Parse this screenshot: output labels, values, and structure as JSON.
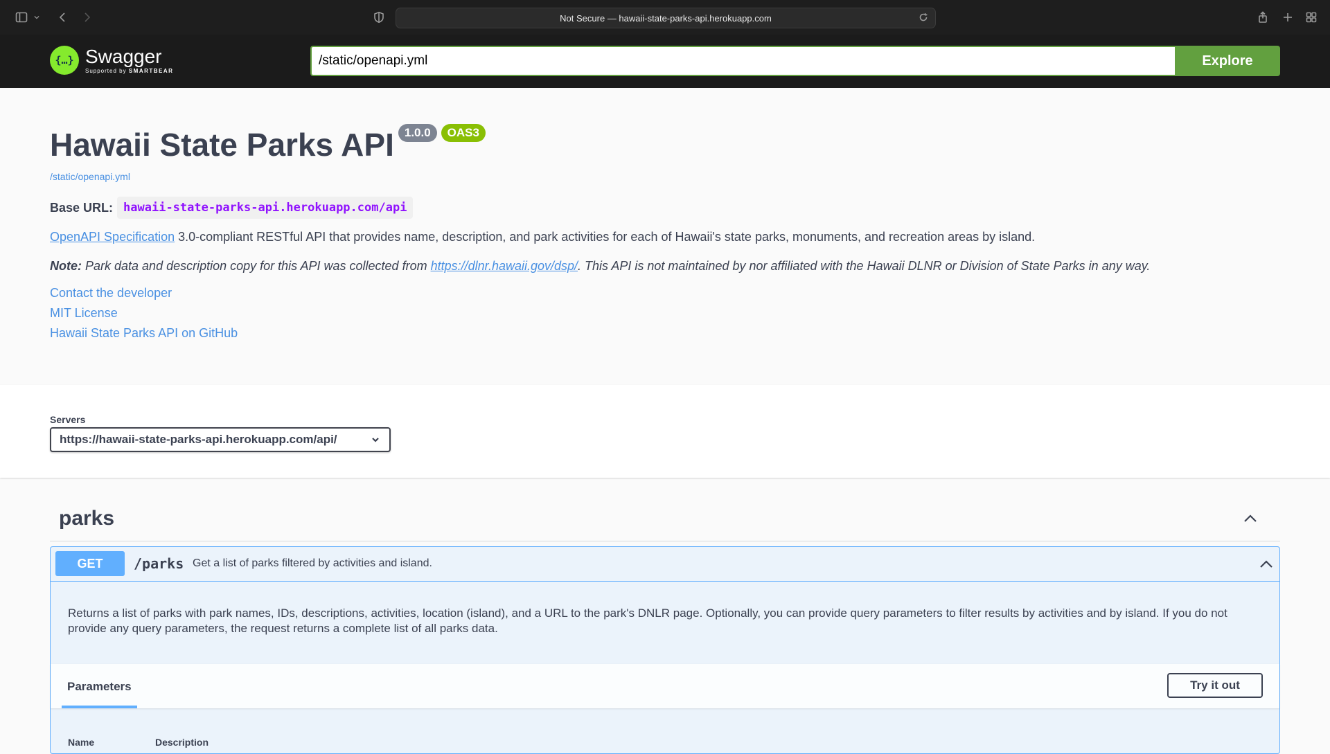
{
  "browser": {
    "url_text": "Not Secure — hawaii-state-parks-api.herokuapp.com"
  },
  "topbar": {
    "logo_word": "Swagger",
    "logo_sub_prefix": "Supported by",
    "logo_sub_brand": "SMARTBEAR",
    "logo_glyph": "{…}",
    "spec_url_value": "/static/openapi.yml",
    "explore_label": "Explore"
  },
  "info": {
    "title": "Hawaii State Parks API",
    "version_badge": "1.0.0",
    "oas_badge": "OAS3",
    "spec_link": "/static/openapi.yml",
    "base_url_label": "Base URL:",
    "base_url_value": "hawaii-state-parks-api.herokuapp.com/api",
    "desc_link": "OpenAPI Specification",
    "desc_text": " 3.0-compliant RESTful API that provides name, description, and park activities for each of Hawaii's state parks, monuments, and recreation areas by island.",
    "note_label": "Note:",
    "note_text_1": " Park data and description copy for this API was collected from ",
    "note_link": "https://dlnr.hawaii.gov/dsp/",
    "note_text_2": ". This API is not maintained by nor affiliated with the Hawaii DLNR or Division of State Parks in any way.",
    "links": [
      "Contact the developer",
      "MIT License",
      "Hawaii State Parks API on GitHub"
    ]
  },
  "servers": {
    "title": "Servers",
    "selected": "https://hawaii-state-parks-api.herokuapp.com/api/"
  },
  "tag": {
    "name": "parks"
  },
  "operation": {
    "method": "GET",
    "path": "/parks",
    "summary": "Get a list of parks filtered by activities and island.",
    "description": "Returns a list of parks with park names, IDs, descriptions, activities, location (island), and a URL to the park's DNLR page. Optionally, you can provide query parameters to filter results by activities and by island. If you do not provide any query parameters, the request returns a complete list of all parks data.",
    "params_tab": "Parameters",
    "try_label": "Try it out",
    "columns": [
      "Name",
      "Description"
    ]
  },
  "colors": {
    "get_method": "#61affe",
    "swagger_green": "#62a03f",
    "link": "#4990e2"
  }
}
